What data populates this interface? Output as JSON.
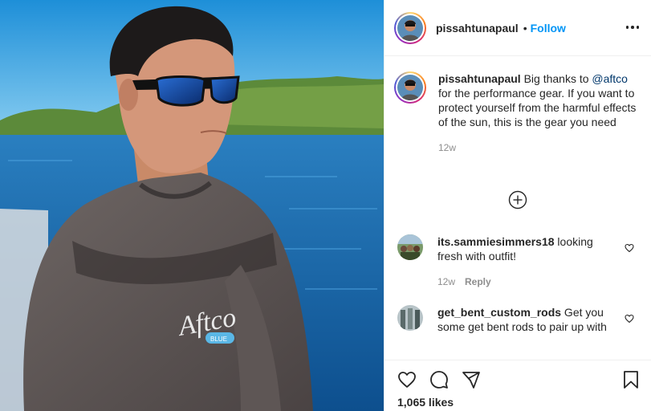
{
  "post": {
    "author": "pissahtunapaul",
    "follow_label": "Follow",
    "dot": "•"
  },
  "caption": {
    "author": "pissahtunapaul",
    "text_before": " Big thanks to ",
    "mention": "@aftco",
    "text_after": " for the performance gear. If you want to protect yourself from the harmful effects of the sun, this is the gear you need",
    "time": "12w"
  },
  "comments": [
    {
      "author": "its.sammiesimmers18",
      "text": " looking fresh with outfit!",
      "time": "12w",
      "reply_label": "Reply"
    },
    {
      "author": "get_bent_custom_rods",
      "text": " Get you some get bent rods to pair up with"
    }
  ],
  "likes": "1,065 likes",
  "photo": {
    "shirt_logo": "Aftco",
    "shirt_badge": "BLUE"
  },
  "colors": {
    "accent": "#0095f6",
    "mention": "#00376b",
    "muted": "#8e8e8e",
    "text": "#262626"
  },
  "icons": {
    "more": "more-options-icon",
    "load_more": "plus-circle-icon",
    "like": "heart-icon",
    "comment": "comment-icon",
    "share": "share-icon",
    "save": "bookmark-icon"
  }
}
